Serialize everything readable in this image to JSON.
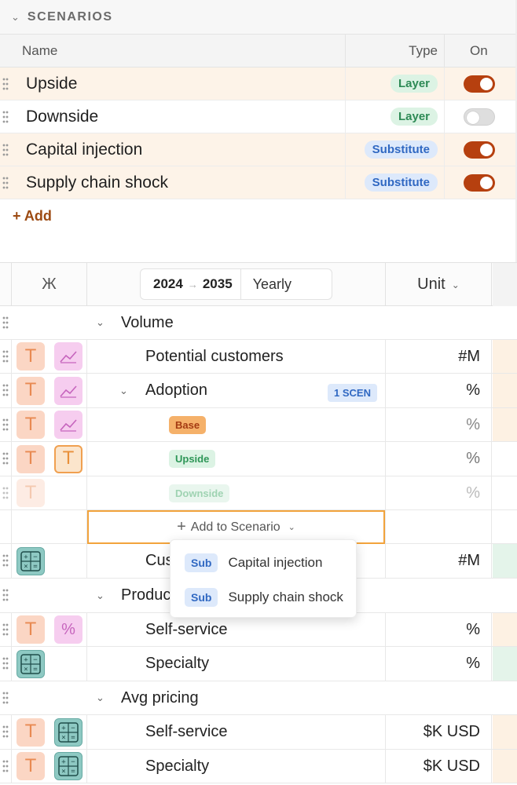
{
  "scenarios": {
    "header": "SCENARIOS",
    "columns": {
      "name": "Name",
      "type": "Type",
      "on": "On"
    },
    "rows": [
      {
        "name": "Upside",
        "type": "Layer",
        "on": true
      },
      {
        "name": "Downside",
        "type": "Layer",
        "on": false
      },
      {
        "name": "Capital injection",
        "type": "Substitute",
        "on": true
      },
      {
        "name": "Supply chain shock",
        "type": "Substitute",
        "on": true
      }
    ],
    "add_label": "+ Add"
  },
  "grid": {
    "header": {
      "glyph": "Ж",
      "start_year": "2024",
      "arrow": "→",
      "end_year": "2035",
      "period": "Yearly",
      "unit_label": "Unit"
    },
    "rows": {
      "volume": "Volume",
      "potential_customers": {
        "label": "Potential customers",
        "unit": "#M"
      },
      "adoption": {
        "label": "Adoption",
        "unit": "%",
        "badge": "1 SCEN"
      },
      "base": {
        "label": "Base",
        "unit": "%"
      },
      "upside": {
        "label": "Upside",
        "unit": "%"
      },
      "downside": {
        "label": "Downside",
        "unit": "%"
      },
      "add_to_scenario": "Add to Scenario",
      "customers": {
        "label": "Cus",
        "unit": "#M"
      },
      "product": "Produc",
      "prod_self_service": {
        "label": "Self-service",
        "unit": "%"
      },
      "prod_specialty": {
        "label": "Specialty",
        "unit": "%"
      },
      "avg_pricing": "Avg pricing",
      "price_self_service": {
        "label": "Self-service",
        "unit": "$K USD"
      },
      "price_specialty": {
        "label": "Specialty",
        "unit": "$K USD"
      }
    },
    "dropdown": [
      {
        "badge": "Sub",
        "label": "Capital injection"
      },
      {
        "badge": "Sub",
        "label": "Supply chain shock"
      }
    ]
  },
  "colors": {
    "accent": "#b6400f",
    "layer_badge": "#2d8a55",
    "substitute_badge": "#3068c2",
    "row_highlight": "#fdf3e8",
    "focus_border": "#f2a33c"
  },
  "icons": {
    "text_cell": "T",
    "percent": "%",
    "calculator": "+−×="
  }
}
